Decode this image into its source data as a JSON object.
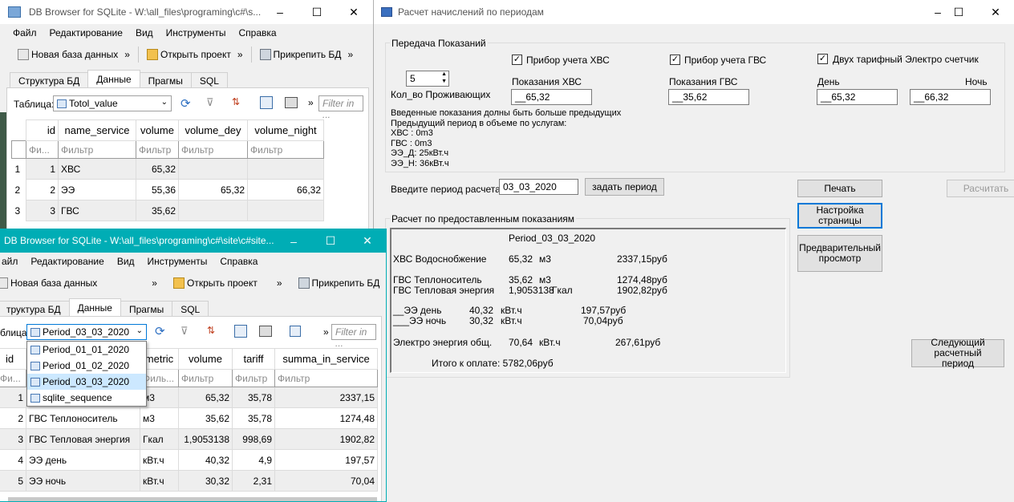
{
  "win1": {
    "title": "DB Browser for SQLite - W:\\all_files\\programing\\c#\\s...",
    "menu": [
      "Файл",
      "Редактирование",
      "Вид",
      "Инструменты",
      "Справка"
    ],
    "toolbar": {
      "new_db": "Новая база данных",
      "open_project": "Открыть проект",
      "attach_db": "Прикрепить БД",
      "more": "»"
    },
    "tabs": [
      "Структура БД",
      "Данные",
      "Прагмы",
      "SQL"
    ],
    "table_label": "Таблица:",
    "table_value": "Totol_value",
    "filter_placeholder": "Filter in ...",
    "columns": [
      "id",
      "name_service",
      "volume",
      "volume_dey",
      "volume_night"
    ],
    "filters": [
      "Фи...",
      "Фильтр",
      "Фильтр",
      "Фильтр",
      "Фильтр"
    ],
    "rows": [
      {
        "rn": "1",
        "cells": [
          "1",
          "ХВС",
          "65,32",
          "",
          ""
        ]
      },
      {
        "rn": "2",
        "cells": [
          "2",
          "ЭЭ",
          "55,36",
          "65,32",
          "66,32"
        ]
      },
      {
        "rn": "3",
        "cells": [
          "3",
          "ГВС",
          "35,62",
          "",
          ""
        ]
      }
    ]
  },
  "win2": {
    "title": "DB Browser for SQLite - W:\\all_files\\programing\\c#\\site\\c#site...",
    "menu": [
      "айл",
      "Редактирование",
      "Вид",
      "Инструменты",
      "Справка"
    ],
    "toolbar": {
      "new_db": "Новая база данных",
      "open_project": "Открыть проект",
      "attach_db": "Прикрепить БД",
      "more": "»"
    },
    "tabs": [
      "труктура БД",
      "Данные",
      "Прагмы",
      "SQL"
    ],
    "table_label": "блица:",
    "table_value": "Period_03_03_2020",
    "filter_placeholder": "Filter in ...",
    "dropdown": [
      "Period_01_01_2020",
      "Period_01_02_2020",
      "Period_03_03_2020",
      "sqlite_sequence"
    ],
    "columns": [
      "id",
      "",
      "metric",
      "volume",
      "tariff",
      "summa_in_service"
    ],
    "filters": [
      "Фи...",
      "",
      "Филь...",
      "Фильтр",
      "Фильтр",
      "Фильтр"
    ],
    "rows": [
      {
        "rn": "1",
        "cells": [
          "",
          "",
          "м3",
          "65,32",
          "35,78",
          "2337,15"
        ]
      },
      {
        "rn": "2",
        "cells": [
          "",
          "ГВС Теплоноситель",
          "м3",
          "35,62",
          "35,78",
          "1274,48"
        ]
      },
      {
        "rn": "3",
        "cells": [
          "",
          "ГВС Тепловая энергия",
          "Гкал",
          "1,9053138",
          "998,69",
          "1902,82"
        ]
      },
      {
        "rn": "4",
        "cells": [
          "",
          "ЭЭ день",
          "кВт.ч",
          "40,32",
          "4,9",
          "197,57"
        ]
      },
      {
        "rn": "5",
        "cells": [
          "",
          "ЭЭ ночь",
          "кВт.ч",
          "30,32",
          "2,31",
          "70,04"
        ]
      }
    ]
  },
  "app": {
    "title": "Расчет начислений по периодам",
    "group1": "Передача Показаний",
    "chk_hvs": "Прибор учета ХВС",
    "chk_gvs": "Прибор учета ГВС",
    "chk_ee": "Двух тарифный Электро счетчик",
    "spin_value": "5",
    "residents_label": "Кол_во Проживающих",
    "hvs_label": "Показания ХВС",
    "hvs_value": "__65,32",
    "gvs_label": "Показания ГВС",
    "gvs_value": "__35,62",
    "day_label": "День",
    "day_value": "__65,32",
    "night_label": "Ночь",
    "night_value": "__66,32",
    "info": [
      "Введенные показания долны быть больше предыдущих",
      "Предыдущий период в объеме по услугам:",
      "ХВС : 0m3",
      "ГВС : 0m3",
      "ЭЭ_Д: 25кВт.ч",
      "ЭЭ_Н: 36кВт.ч"
    ],
    "period_label": "Введите период расчета",
    "period_value": "03_03_2020",
    "set_period_btn": "задать период",
    "print_btn": "Печать",
    "calc_btn": "Расчитать",
    "page_setup_btn": "Настройка страницы",
    "preview_btn": "Предварительный просмотр",
    "next_period_btn": "Следующий расчетный период",
    "group2": "Расчет по предоставленным показаниям",
    "report": {
      "period": "Period_03_03_2020",
      "hvs": {
        "name": "ХВС Водоснобжение",
        "vol": "65,32",
        "unit": "м3",
        "sum": "2337,15руб"
      },
      "gvs1": {
        "name": "ГВС Теплоноситель",
        "vol": "35,62",
        "unit": "м3",
        "sum": "1274,48руб"
      },
      "gvs2": {
        "name": "ГВС Тепловая энергия",
        "vol": "1,9053138",
        "unit": "Гкал",
        "sum": "1902,82руб"
      },
      "ee_day": {
        "name": "__ЭЭ день",
        "vol": "40,32",
        "unit": "кВт.ч",
        "sum": "197,57руб"
      },
      "ee_night": {
        "name": "___ЭЭ ночь",
        "vol": "30,32",
        "unit": "кВт.ч",
        "sum": "70,04руб"
      },
      "ee_total": {
        "name": "Электро энергия общ.",
        "vol": "70,64",
        "unit": "кВт.ч",
        "sum": "267,61руб"
      },
      "total": "Итого к оплате: 5782,06руб"
    }
  },
  "colors": {
    "accent": "#00adb5",
    "selection": "#cce8ff",
    "button_border": "#0078d7"
  }
}
